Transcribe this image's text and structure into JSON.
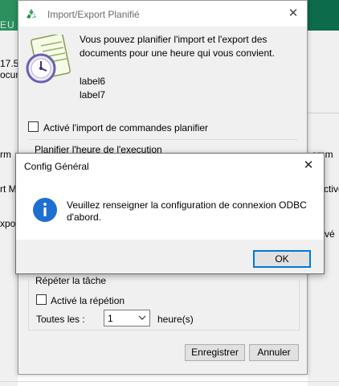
{
  "background_app": {
    "logo_text": "EU",
    "left_texts": [
      "17.5",
      "ocum",
      "rm",
      "rt M",
      "xpor"
    ],
    "right_texts": [
      "omm",
      "ctive",
      "vé"
    ]
  },
  "import_export_window": {
    "title": "Import/Export Planifié",
    "close_symbol": "✕",
    "description": "Vous pouvez planifier l'import et l'export des documents pour une heure qui vous convient.",
    "label6": "label6",
    "label7": "label7",
    "import_checkbox": {
      "label": "Activé l'import de commandes planifier",
      "checked": false
    },
    "execution_group_label": "Planifier l'heure de l'execution",
    "repeat_group": {
      "label": "Répéter la tâche",
      "repeat_checkbox": {
        "label": "Activé la répétion",
        "checked": false
      },
      "every_label": "Toutes les :",
      "every_value": "1",
      "unit_label": "heure(s)"
    },
    "buttons": {
      "save": "Enregistrer",
      "cancel": "Annuler"
    }
  },
  "config_dialog": {
    "title": "Config Général",
    "close_symbol": "✕",
    "message": "Veuillez renseigner la configuration de connexion ODBC d'abord.",
    "ok_label": "OK"
  },
  "colors": {
    "banner": "#0c6b4b",
    "info_icon": "#1f6fd1",
    "focus_border": "#0078d7"
  }
}
